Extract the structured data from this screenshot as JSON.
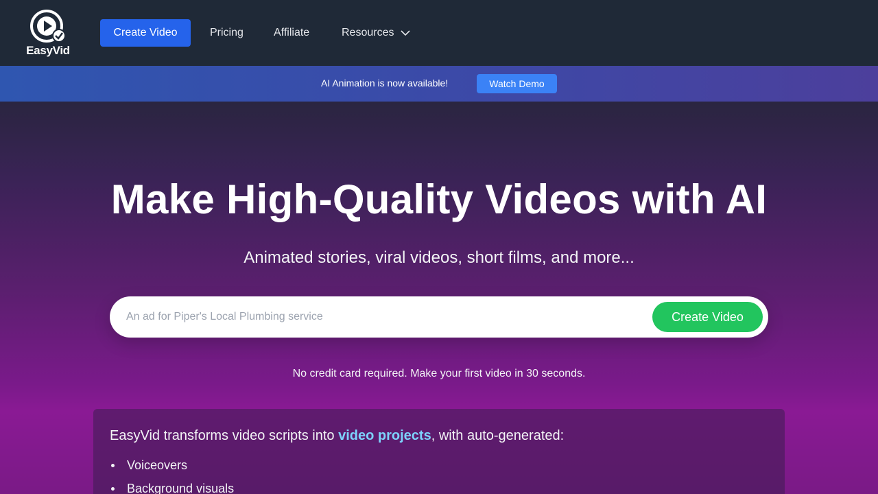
{
  "nav": {
    "logo_text": "EasyVid",
    "create_video": "Create Video",
    "pricing": "Pricing",
    "affiliate": "Affiliate",
    "resources": "Resources"
  },
  "banner": {
    "text": "AI Animation is now available!",
    "button": "Watch Demo"
  },
  "hero": {
    "title": "Make High-Quality Videos with AI",
    "subtitle": "Animated stories, viral videos, short films, and more...",
    "input_placeholder": "An ad for Piper's Local Plumbing service",
    "input_value": "",
    "create_button": "Create Video",
    "note": "No credit card required. Make your first video in 30 seconds."
  },
  "info": {
    "intro_before": "EasyVid transforms video scripts into ",
    "intro_link": "video projects",
    "intro_after": ", with auto-generated:",
    "items": [
      "Voiceovers",
      "Background visuals"
    ]
  },
  "colors": {
    "nav_bg": "#1f2937",
    "primary_button": "#2563eb",
    "cta_green": "#22c55e",
    "link_cyan": "#7dd3fc"
  },
  "icons": {
    "logo": "play-check-logo-icon",
    "resources_dropdown": "chevron-down-icon"
  }
}
